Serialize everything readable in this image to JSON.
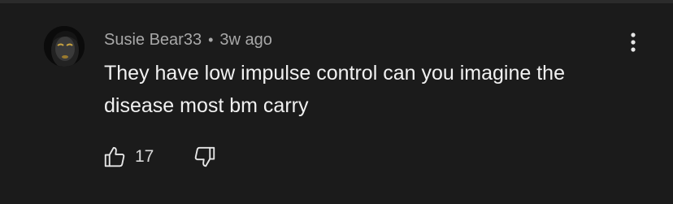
{
  "comment": {
    "author": "Susie Bear33",
    "separator": "•",
    "timestamp": "3w ago",
    "text": "They have low impulse control can you imagine the disease most bm carry",
    "like_count": "17",
    "icons": {
      "more": "more-vertical-icon",
      "like": "thumbs-up-icon",
      "dislike": "thumbs-down-icon",
      "avatar": "avatar-image"
    }
  },
  "colors": {
    "background": "#1b1b1b",
    "primary_text": "#f1f1f1",
    "secondary_text": "#a8a8a8",
    "icon": "#e6e6e6"
  }
}
